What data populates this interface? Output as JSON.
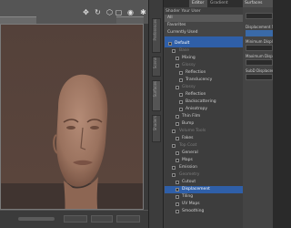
{
  "panel": {
    "tabs": [
      {
        "label": "Editor"
      },
      {
        "label": "Gradient"
      }
    ],
    "title": "Shader  Your User",
    "filters": [
      {
        "label": "All"
      },
      {
        "label": "Favorites"
      },
      {
        "label": "Currently Used"
      }
    ]
  },
  "strip": {
    "tabs": [
      "Preferences",
      "Scene",
      "Surfaces",
      "Shaders"
    ]
  },
  "tree": {
    "rows": [
      {
        "label": "Default"
      },
      {
        "label": "Base"
      },
      {
        "label": "Mixing"
      },
      {
        "label": "Glossy"
      },
      {
        "label": "Reflection"
      },
      {
        "label": "Translucency"
      },
      {
        "label": "Glossy"
      },
      {
        "label": "Reflection"
      },
      {
        "label": "Backscattering"
      },
      {
        "label": "Anisotropy"
      },
      {
        "label": "Thin Film"
      },
      {
        "label": "Bump"
      },
      {
        "label": "Volume Tools"
      },
      {
        "label": "Fakes"
      },
      {
        "label": "Top Coat"
      },
      {
        "label": "General"
      },
      {
        "label": "Maps"
      },
      {
        "label": "Emission"
      },
      {
        "label": "Geometry"
      },
      {
        "label": "Cutout"
      },
      {
        "label": "Displacement"
      },
      {
        "label": "Tiling"
      },
      {
        "label": "UV Maps"
      },
      {
        "label": "Smoothing"
      }
    ]
  },
  "props": {
    "tabs": [
      {
        "label": "Surfaces"
      }
    ],
    "rows": [
      {
        "label": "Displacement Str"
      },
      {
        "label": "Minimum Displace"
      },
      {
        "label": "Maximum Displace"
      },
      {
        "label": "SubD Displacement"
      }
    ]
  },
  "colors": {
    "selection": "#2f5fa8",
    "skin": "#a9826d"
  }
}
